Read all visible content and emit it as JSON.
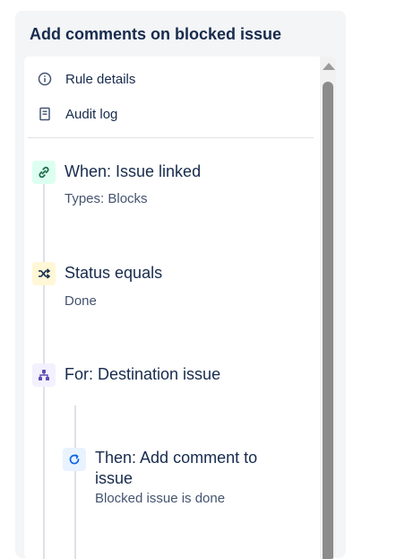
{
  "panel": {
    "title": "Add comments on blocked issue"
  },
  "menu": {
    "items": [
      {
        "icon": "info-icon",
        "label": "Rule details"
      },
      {
        "icon": "audit-log-icon",
        "label": "Audit log"
      }
    ]
  },
  "steps": [
    {
      "icon": "link-icon",
      "title": "When: Issue linked",
      "subtitle": "Types: Blocks",
      "color": "#216e4e",
      "bg": "#dcfff1"
    },
    {
      "icon": "shuffle-icon",
      "title": "Status equals",
      "subtitle": "Done",
      "color": "#172b4d",
      "bg": "#fff7d6"
    },
    {
      "icon": "hierarchy-icon",
      "title": "For: Destination issue",
      "subtitle": "",
      "color": "#5e4db2",
      "bg": "#f3f0ff"
    },
    {
      "icon": "refresh-icon",
      "title_line1": "Then: Add comment to",
      "title_line2": "issue",
      "subtitle": "Blocked issue is done",
      "color": "#0c66e4",
      "bg": "#e9f2ff"
    }
  ]
}
